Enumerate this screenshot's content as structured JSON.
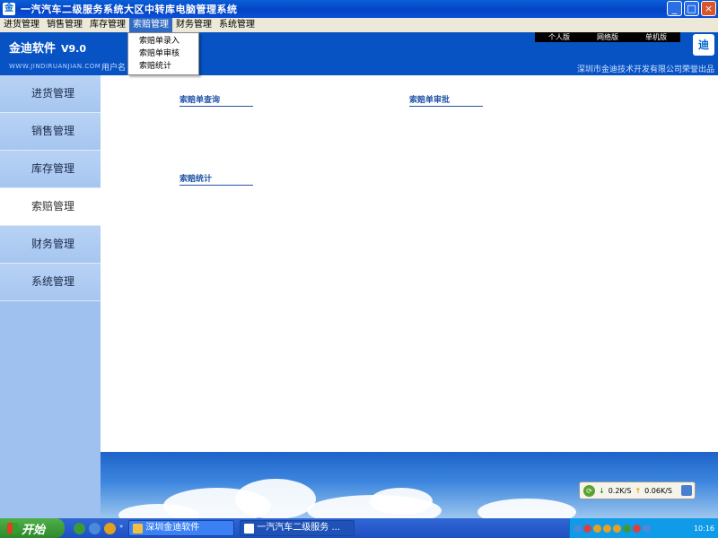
{
  "window": {
    "title": "一汽汽车二级服务系统大区中转库电脑管理系统",
    "minimize_glyph": "_",
    "maximize_glyph": "□",
    "close_glyph": "×"
  },
  "menubar": [
    "进货管理",
    "销售管理",
    "库存管理",
    "索赔管理",
    "财务管理",
    "系统管理"
  ],
  "dropdown": [
    "索赔单录入",
    "索赔单审核",
    "索赔统计"
  ],
  "header": {
    "brand": "金迪软件",
    "version": "V9.0",
    "site": "WWW.JINDIRUANJIAN.COM",
    "user_label": "用户名",
    "top_buttons": [
      "个人版",
      "网络版",
      "单机版"
    ],
    "company": "深圳市金迪技术开发有限公司荣誉出品",
    "logo_text": "迪"
  },
  "sidebar": [
    "进货管理",
    "销售管理",
    "库存管理",
    "索赔管理",
    "财务管理",
    "系统管理"
  ],
  "main_links": {
    "query": "索赔单查询",
    "approve": "索赔单审批",
    "stats": "索赔统计"
  },
  "network": {
    "down": "0.2K/S",
    "up": "0.06K/S"
  },
  "taskbar": {
    "start": "开始",
    "quicklaunch_count": "»",
    "task1": "深圳金迪软件",
    "task2": "一汽汽车二级服务 ...",
    "clock": "10:16"
  },
  "colors": {
    "header_blue": "#0753c4",
    "sidebar_blue": "#9ec1ef",
    "menu_highlight": "#316ac5"
  }
}
